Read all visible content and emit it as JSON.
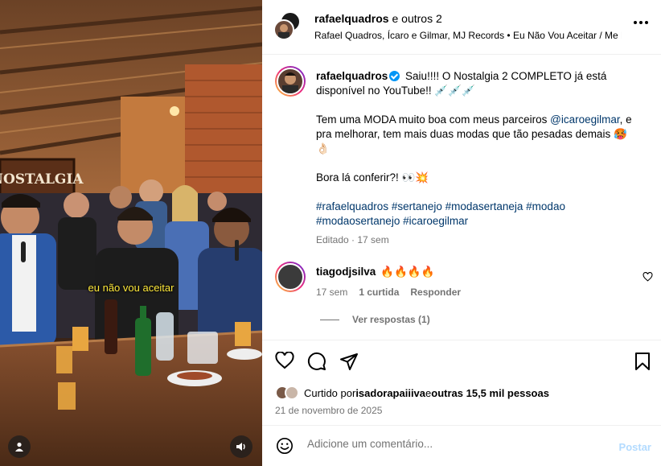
{
  "media": {
    "subtitle": "eu não vou aceitar",
    "sign_text": "NOSTALGIA",
    "user_icon": "user-icon",
    "sound_icon": "volume-icon"
  },
  "header": {
    "author": "rafaelquadros",
    "and_others": "e outros 2",
    "subtitle": "Rafael Quadros, Ícaro e Gilmar, MJ Records • Eu Não Vou Aceitar / Me Esqueci",
    "more_icon": "more-options-icon"
  },
  "caption": {
    "username": "rafaelquadros",
    "line1": "Saiu!!!! O Nostalgia 2 COMPLETO já está disponível no YouTube!! 💉💉💉",
    "line2_before": "Tem uma MODA muito boa com meus parceiros ",
    "mention": "@icaroegilmar",
    "line2_after": ", e pra melhorar, tem mais duas modas que tão pesadas demais 🥵👌🏻",
    "line3": "Bora lá conferir?! 👀💥",
    "hashtags": "#rafaelquadros #sertanejo #modasertaneja #modao #modaosertanejo #icaroegilmar",
    "edited": "Editado · 17 sem"
  },
  "comment": {
    "username": "tiagodjsilva",
    "text": "🔥🔥🔥🔥",
    "time": "17 sem",
    "likes": "1 curtida",
    "reply": "Responder",
    "view_replies": "Ver respostas (1)"
  },
  "actions": {
    "like_icon": "heart-icon",
    "comment_icon": "comment-icon",
    "share_icon": "share-icon",
    "save_icon": "bookmark-icon"
  },
  "likes": {
    "prefix": "Curtido por ",
    "user": "isadorapaiiiva",
    "middle": " e ",
    "others": "outras 15,5 mil pessoas"
  },
  "date": "21 de novembro de 2025",
  "add_comment": {
    "placeholder": "Adicione um comentário...",
    "post_label": "Postar"
  },
  "colors": {
    "link": "#00376b",
    "verified": "#0095f6",
    "subtitle_yellow": "#ffe93b",
    "post_disabled": "#b3dbff"
  }
}
